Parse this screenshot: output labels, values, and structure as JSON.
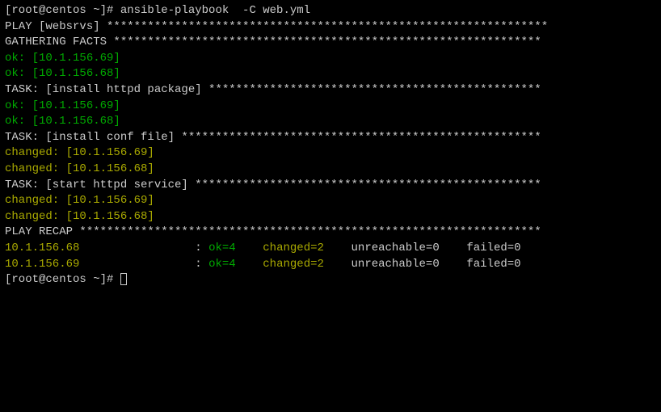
{
  "prompt1": "[root@centos ~]# ",
  "command": "ansible-playbook  -C web.yml",
  "blank": "",
  "play_header": "PLAY [websrvs] ***************************************************************** ",
  "gathering_header": "GATHERING FACTS *************************************************************** ",
  "ok69": "ok: [10.1.156.69]",
  "ok68": "ok: [10.1.156.68]",
  "task1_header": "TASK: [install httpd package] ************************************************* ",
  "task2_header": "TASK: [install conf file] ***************************************************** ",
  "changed69": "changed: [10.1.156.69]",
  "changed68": "changed: [10.1.156.68]",
  "task3_header": "TASK: [start httpd service] *************************************************** ",
  "recap_header": "PLAY RECAP ******************************************************************** ",
  "recap68_host": "10.1.156.68",
  "recap69_host": "10.1.156.69",
  "recap_pad": "                ",
  "recap_colon": " : ",
  "recap_ok": "ok=4",
  "recap_sep1": "    ",
  "recap_changed": "changed=2",
  "recap_sep2": "    ",
  "recap_unreach": "unreachable=0",
  "recap_sep3": "    ",
  "recap_failed": "failed=0",
  "recap_sep4": "   ",
  "prompt2": "[root@centos ~]# "
}
